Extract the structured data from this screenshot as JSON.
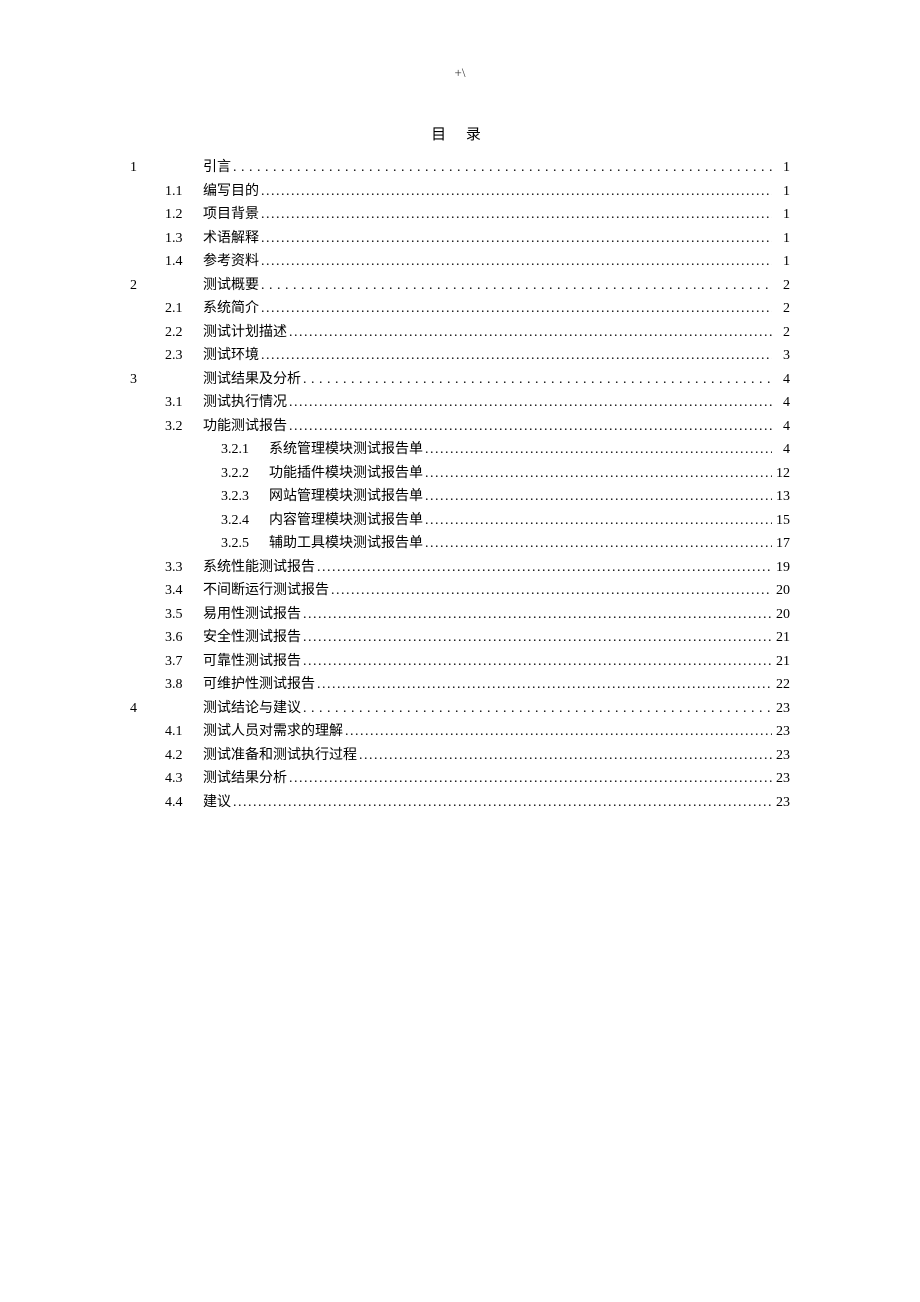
{
  "headerMark": "+\\",
  "tocTitle": "目 录",
  "entries": [
    {
      "level": 1,
      "num": "1",
      "label": "引言",
      "page": "1"
    },
    {
      "level": 2,
      "num": "1.1",
      "label": "编写目的",
      "page": "1"
    },
    {
      "level": 2,
      "num": "1.2",
      "label": "项目背景",
      "page": "1"
    },
    {
      "level": 2,
      "num": "1.3",
      "label": "术语解释",
      "page": "1"
    },
    {
      "level": 2,
      "num": "1.4",
      "label": "参考资料",
      "page": "1"
    },
    {
      "level": 1,
      "num": "2",
      "label": "测试概要",
      "page": "2"
    },
    {
      "level": 2,
      "num": "2.1",
      "label": "系统简介",
      "page": "2"
    },
    {
      "level": 2,
      "num": "2.2",
      "label": "测试计划描述",
      "page": "2"
    },
    {
      "level": 2,
      "num": "2.3",
      "label": "测试环境",
      "page": "3"
    },
    {
      "level": 1,
      "num": "3",
      "label": "测试结果及分析",
      "page": "4"
    },
    {
      "level": 2,
      "num": "3.1",
      "label": "测试执行情况",
      "page": "4"
    },
    {
      "level": 2,
      "num": "3.2",
      "label": "功能测试报告",
      "page": "4"
    },
    {
      "level": 3,
      "num": "3.2.1",
      "label": "系统管理模块测试报告单",
      "page": "4"
    },
    {
      "level": 3,
      "num": "3.2.2",
      "label": "功能插件模块测试报告单",
      "page": "12"
    },
    {
      "level": 3,
      "num": "3.2.3",
      "label": "网站管理模块测试报告单",
      "page": "13"
    },
    {
      "level": 3,
      "num": "3.2.4",
      "label": "内容管理模块测试报告单",
      "page": "15"
    },
    {
      "level": 3,
      "num": "3.2.5",
      "label": "辅助工具模块测试报告单",
      "page": "17"
    },
    {
      "level": 2,
      "num": "3.3",
      "label": "系统性能测试报告",
      "page": "19"
    },
    {
      "level": 2,
      "num": "3.4",
      "label": "不间断运行测试报告",
      "page": "20"
    },
    {
      "level": 2,
      "num": "3.5",
      "label": "易用性测试报告",
      "page": "20"
    },
    {
      "level": 2,
      "num": "3.6",
      "label": "安全性测试报告",
      "page": "21"
    },
    {
      "level": 2,
      "num": "3.7",
      "label": "可靠性测试报告",
      "page": "21"
    },
    {
      "level": 2,
      "num": "3.8",
      "label": "可维护性测试报告",
      "page": "22"
    },
    {
      "level": 1,
      "num": "4",
      "label": "测试结论与建议",
      "page": "23"
    },
    {
      "level": 2,
      "num": "4.1",
      "label": "测试人员对需求的理解",
      "page": "23"
    },
    {
      "level": 2,
      "num": "4.2",
      "label": "测试准备和测试执行过程",
      "page": "23"
    },
    {
      "level": 2,
      "num": "4.3",
      "label": "测试结果分析",
      "page": "23"
    },
    {
      "level": 2,
      "num": "4.4",
      "label": "建议",
      "page": "23"
    }
  ]
}
